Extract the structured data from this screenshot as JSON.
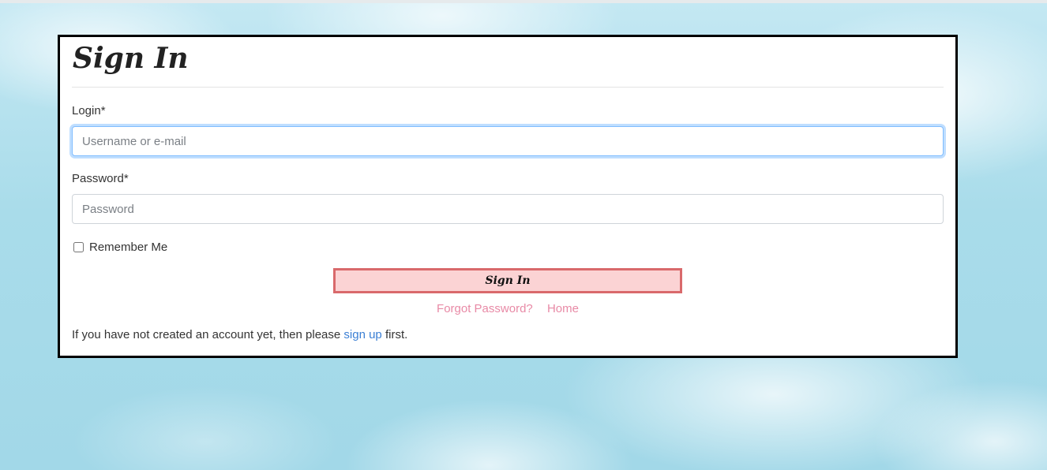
{
  "form": {
    "title": "Sign In",
    "login_label": "Login*",
    "login_placeholder": "Username or e-mail",
    "password_label": "Password*",
    "password_placeholder": "Password",
    "remember_label": "Remember Me",
    "remember_checked": false,
    "submit_label": "Sign In"
  },
  "links": {
    "forgot_password": "Forgot Password?",
    "home": "Home"
  },
  "signup": {
    "prefix": "If you have not created an account yet, then please ",
    "link": "sign up",
    "suffix": " first."
  },
  "colors": {
    "button_fill": "#fbd3d4",
    "button_border": "#d9696b",
    "link_pink": "#e88aa6",
    "link_blue": "#3b7fd4",
    "card_border": "#000000"
  }
}
